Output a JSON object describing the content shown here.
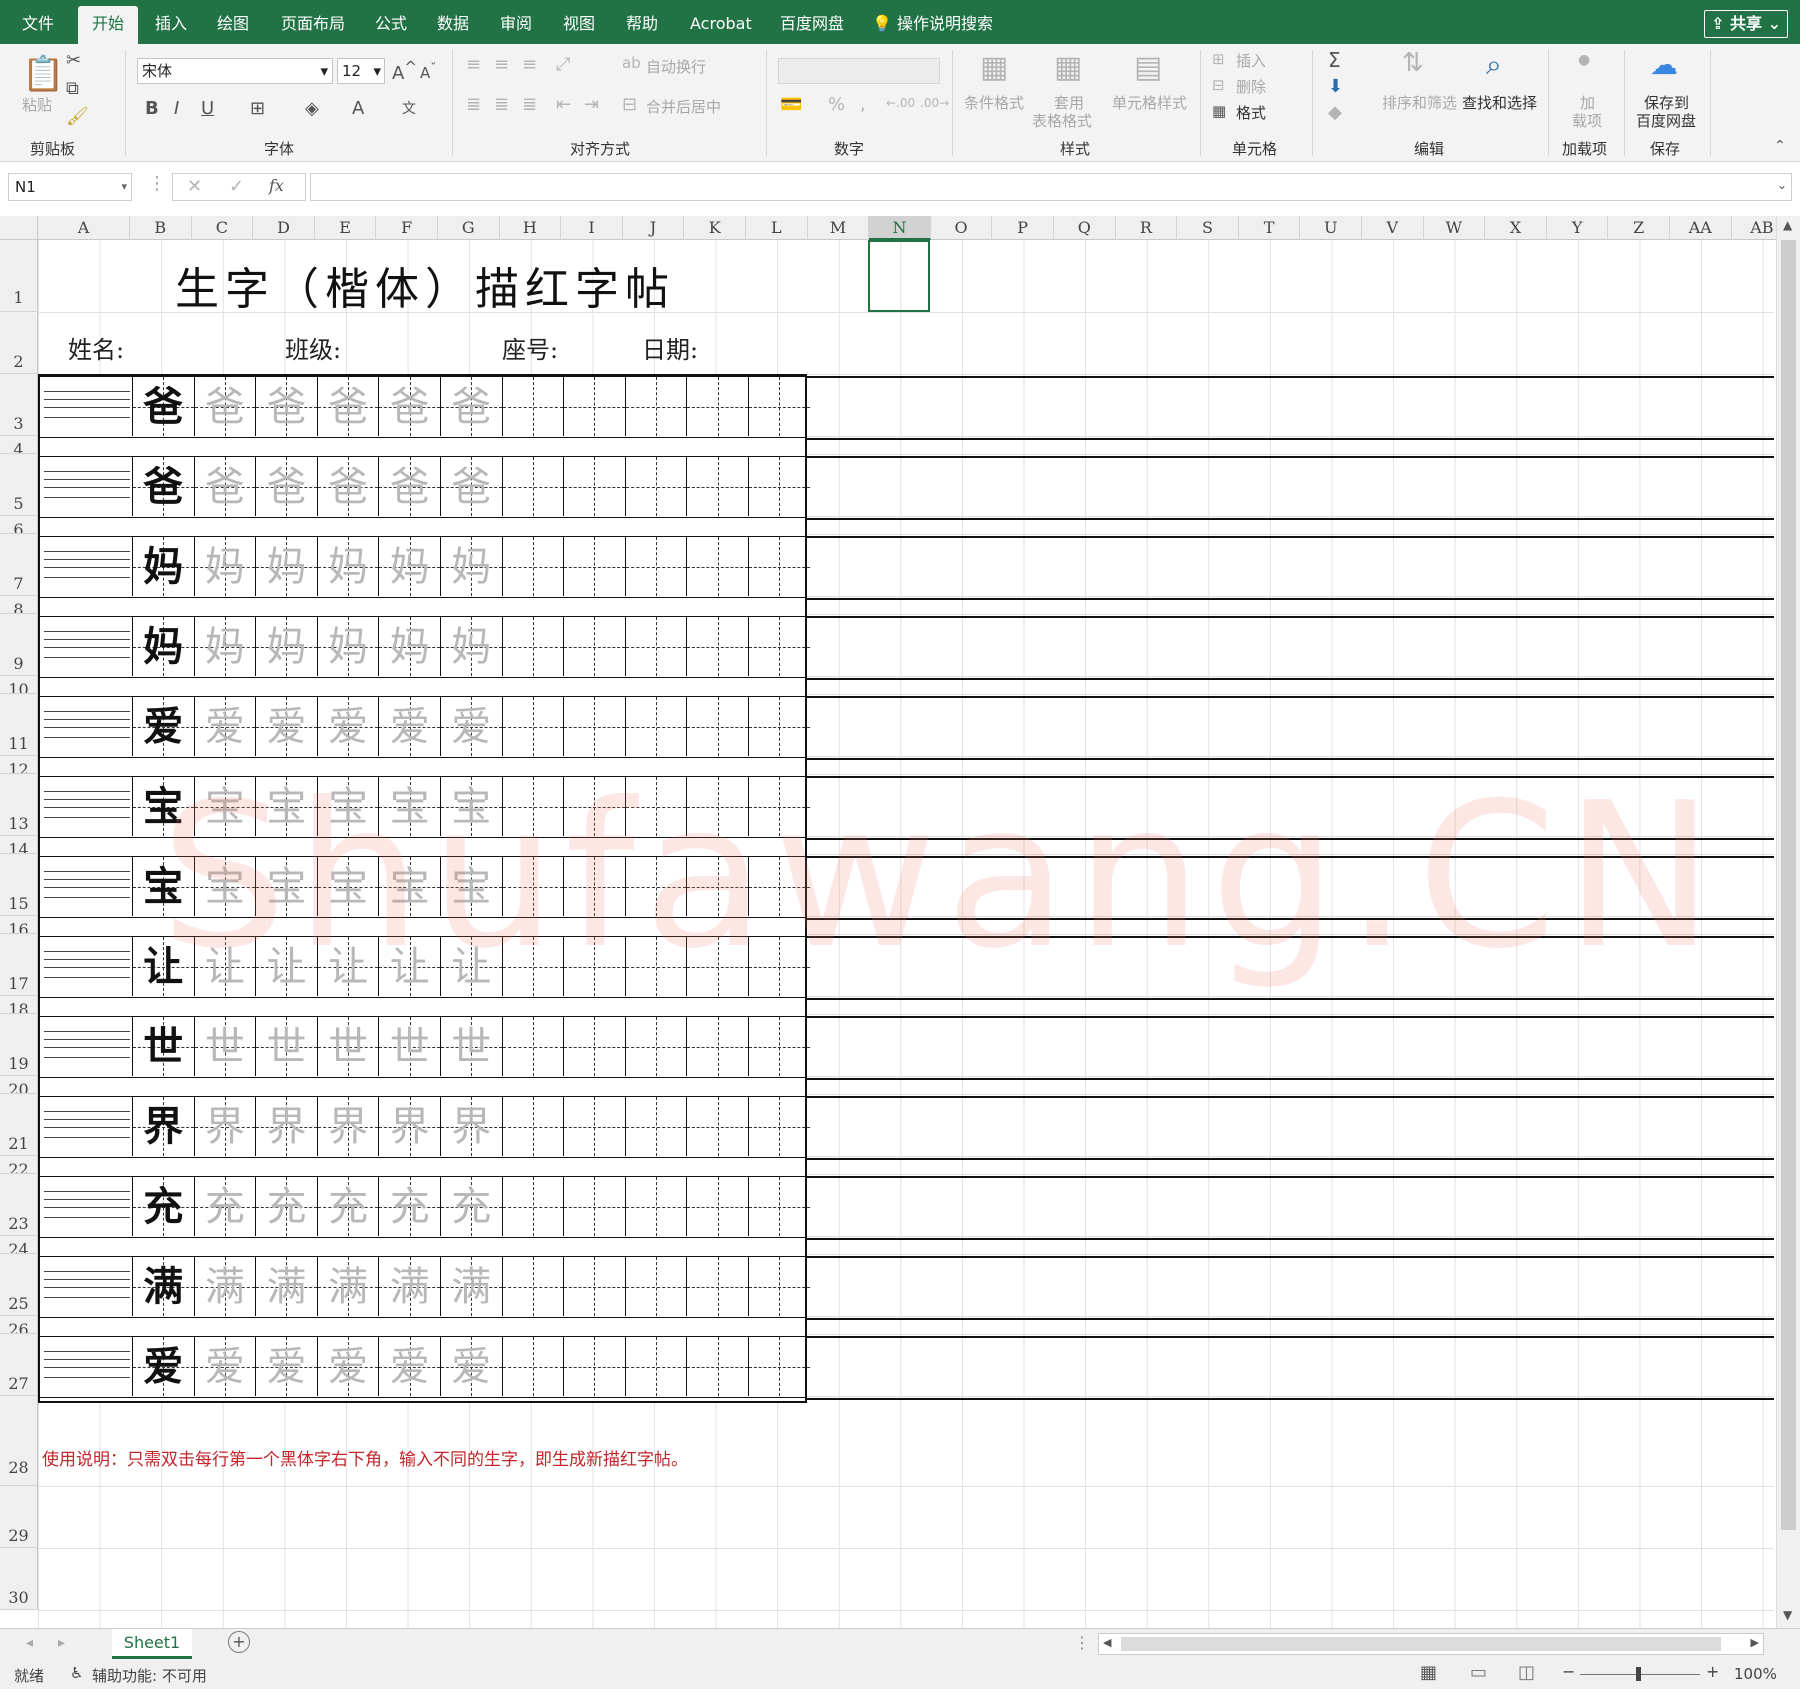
{
  "tabs": [
    "文件",
    "开始",
    "插入",
    "绘图",
    "页面布局",
    "公式",
    "数据",
    "审阅",
    "视图",
    "帮助",
    "Acrobat",
    "百度网盘"
  ],
  "tell_me": "操作说明搜索",
  "share": "共享",
  "ribbon": {
    "paste": "粘贴",
    "clipboard": "剪贴板",
    "font_name": "宋体",
    "font_size": "12",
    "font_group": "字体",
    "wrap": "自动换行",
    "merge": "合并后居中",
    "align_group": "对齐方式",
    "number_group": "数字",
    "cond_format": "条件格式",
    "table_format_1": "套用",
    "table_format_2": "表格格式",
    "cell_style": "单元格样式",
    "style_group": "样式",
    "insert": "插入",
    "delete": "删除",
    "format": "格式",
    "cells_group": "单元格",
    "sort_filter": "排序和筛选",
    "find_select": "查找和选择",
    "edit_group": "编辑",
    "addin_1": "加",
    "addin_2": "载项",
    "addin_group": "加载项",
    "save_baidu_1": "保存到",
    "save_baidu_2": "百度网盘",
    "save_group": "保存"
  },
  "name_box": "N1",
  "columns": [
    "A",
    "B",
    "C",
    "D",
    "E",
    "F",
    "G",
    "H",
    "I",
    "J",
    "K",
    "L",
    "M",
    "N",
    "O",
    "P",
    "Q",
    "R",
    "S",
    "T",
    "U",
    "V",
    "W",
    "X",
    "Y",
    "Z",
    "AA",
    "AB"
  ],
  "rows": [
    "1",
    "2",
    "3",
    "4",
    "5",
    "6",
    "7",
    "8",
    "9",
    "10",
    "11",
    "12",
    "13",
    "14",
    "15",
    "16",
    "17",
    "18",
    "19",
    "20",
    "21",
    "22",
    "23",
    "24",
    "25",
    "26",
    "27",
    "28",
    "29",
    "30"
  ],
  "sheet": {
    "title": "生字（楷体）描红字帖",
    "name_label": "姓名:",
    "class_label": "班级:",
    "seat_label": "座号:",
    "date_label": "日期:",
    "characters": [
      "爸",
      "爸",
      "妈",
      "妈",
      "爱",
      "宝",
      "宝",
      "让",
      "世",
      "界",
      "充",
      "满",
      "爱"
    ],
    "instruction": "使用说明：只需双击每行第一个黑体字右下角，输入不同的生字，即生成新描红字帖。",
    "watermark": "Shufawang.CN"
  },
  "sheet_tab": "Sheet1",
  "status": {
    "ready": "就绪",
    "accessibility": "辅助功能: 不可用",
    "zoom": "100%"
  }
}
